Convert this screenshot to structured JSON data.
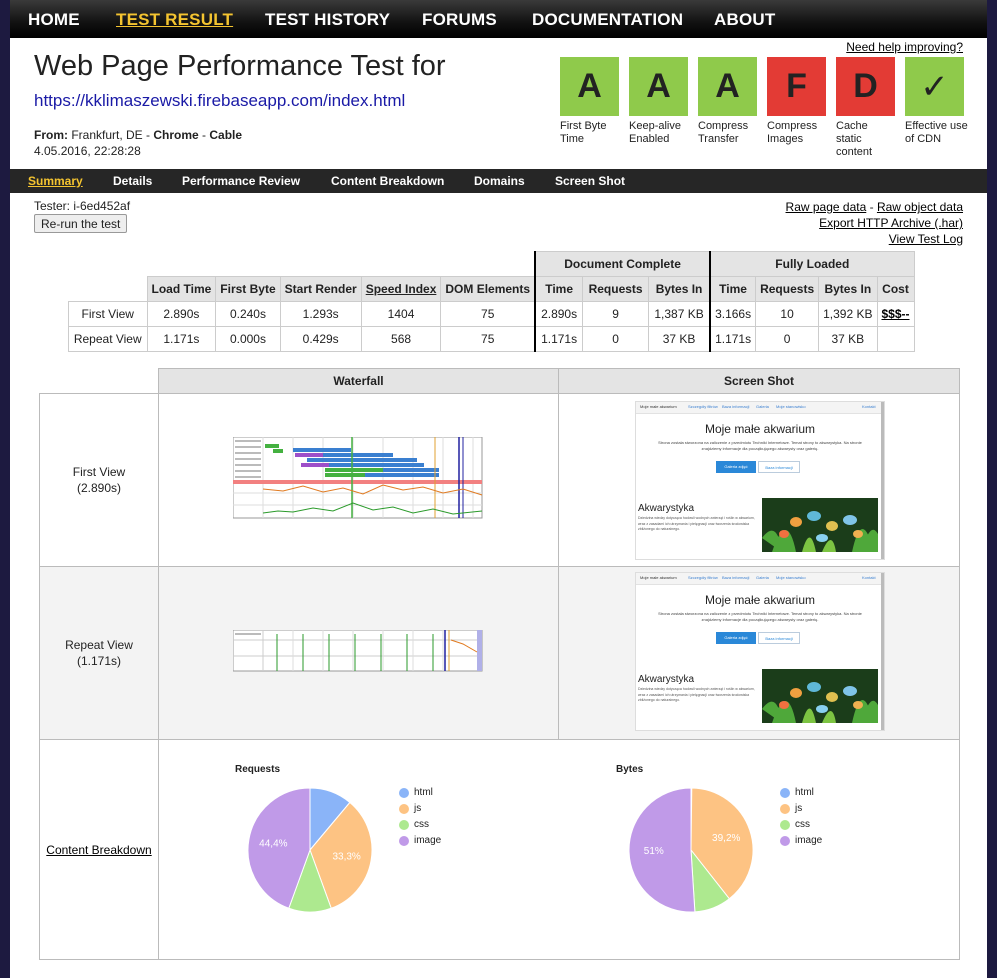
{
  "nav": {
    "items": [
      "HOME",
      "TEST RESULT",
      "TEST HISTORY",
      "FORUMS",
      "DOCUMENTATION",
      "ABOUT"
    ],
    "active": "TEST RESULT"
  },
  "header": {
    "title": "Web Page Performance Test for",
    "url": "https://kklimaszewski.firebaseapp.com/index.html",
    "from_label": "From:",
    "from_location": " Frankfurt, DE - ",
    "browser": "Chrome",
    "dash": " - ",
    "connection": "Cable",
    "date": "4.05.2016, 22:28:28",
    "help_link": "Need help improving?"
  },
  "grades": [
    {
      "grade": "A",
      "label": "First Byte Time",
      "color": "#8fca4b"
    },
    {
      "grade": "A",
      "label": "Keep-alive Enabled",
      "color": "#8fca4b"
    },
    {
      "grade": "A",
      "label": "Compress Transfer",
      "color": "#8fca4b"
    },
    {
      "grade": "F",
      "label": "Compress Images",
      "color": "#e33b35"
    },
    {
      "grade": "D",
      "label": "Cache static content",
      "color": "#e33b35"
    },
    {
      "grade": "✓",
      "label": "Effective use of CDN",
      "color": "#8fca4b"
    }
  ],
  "subnav": {
    "items": [
      "Summary",
      "Details",
      "Performance Review",
      "Content Breakdown",
      "Domains",
      "Screen Shot"
    ],
    "active": "Summary"
  },
  "tester": "Tester: i-6ed452af",
  "rerun_label": "Re-run the test",
  "links": {
    "raw_page": "Raw page data",
    "sep": " - ",
    "raw_object": "Raw object data",
    "har": "Export HTTP Archive (.har)",
    "log": "View Test Log"
  },
  "results": {
    "group_headers": {
      "doc_complete": "Document Complete",
      "fully_loaded": "Fully Loaded"
    },
    "columns": [
      "Load Time",
      "First Byte",
      "Start Render",
      "Speed Index",
      "DOM Elements",
      "Time",
      "Requests",
      "Bytes In",
      "Time",
      "Requests",
      "Bytes In",
      "Cost"
    ],
    "rows": [
      {
        "label": "First View",
        "cells": [
          "2.890s",
          "0.240s",
          "1.293s",
          "1404",
          "75",
          "2.890s",
          "9",
          "1,387 KB",
          "3.166s",
          "10",
          "1,392 KB",
          "$$$--"
        ]
      },
      {
        "label": "Repeat View",
        "cells": [
          "1.171s",
          "0.000s",
          "0.429s",
          "568",
          "75",
          "1.171s",
          "0",
          "37 KB",
          "1.171s",
          "0",
          "37 KB",
          ""
        ]
      }
    ]
  },
  "grid": {
    "waterfall_header": "Waterfall",
    "screenshot_header": "Screen Shot",
    "first_view": {
      "label": "First View",
      "time": "(2.890s)"
    },
    "repeat_view": {
      "label": "Repeat View",
      "time": "(1.171s)"
    },
    "content_breakdown": "Content Breakdown"
  },
  "screenshot": {
    "nav_items": [
      "Moje małe akwarium",
      "Szczegóły filtrów",
      "Baza informacji",
      "Galeria",
      "Moje stanowisko",
      "Kontakt"
    ],
    "site_title": "Moje małe akwarium",
    "intro": "Strona została stworzona na zaliczenie z przedmiotu Techniki Internetowe. Temat strony to akwarystyka. Na stronie znajdziemy informacje dla początkującego akwarysty oraz galerię.",
    "btn_primary": "Galeria zdjęć",
    "btn_secondary": "Baza informacji",
    "section_title": "Akwarystyka",
    "section_text": "Dziedzina wiedzy dotycząca hodowli wodnych zwierząt i roślin w akwarium, wraz z zasadami ich utrzymania i pielęgnacji oraz tworzenia środowiska zbliżonego do naturalnego."
  },
  "chart_data": [
    {
      "type": "pie",
      "title": "Requests",
      "categories": [
        "html",
        "js",
        "css",
        "image"
      ],
      "values": [
        11.1,
        33.3,
        11.1,
        44.4
      ],
      "labels": [
        "",
        "33,3%",
        "",
        "44,4%"
      ],
      "colors": [
        "#8ab4f8",
        "#fdc383",
        "#ade98f",
        "#c09ae8"
      ]
    },
    {
      "type": "pie",
      "title": "Bytes",
      "categories": [
        "html",
        "js",
        "css",
        "image"
      ],
      "values": [
        0.2,
        39.2,
        9.6,
        51
      ],
      "labels": [
        "",
        "39,2%",
        "",
        "51%"
      ],
      "colors": [
        "#8ab4f8",
        "#fdc383",
        "#ade98f",
        "#c09ae8"
      ]
    }
  ]
}
